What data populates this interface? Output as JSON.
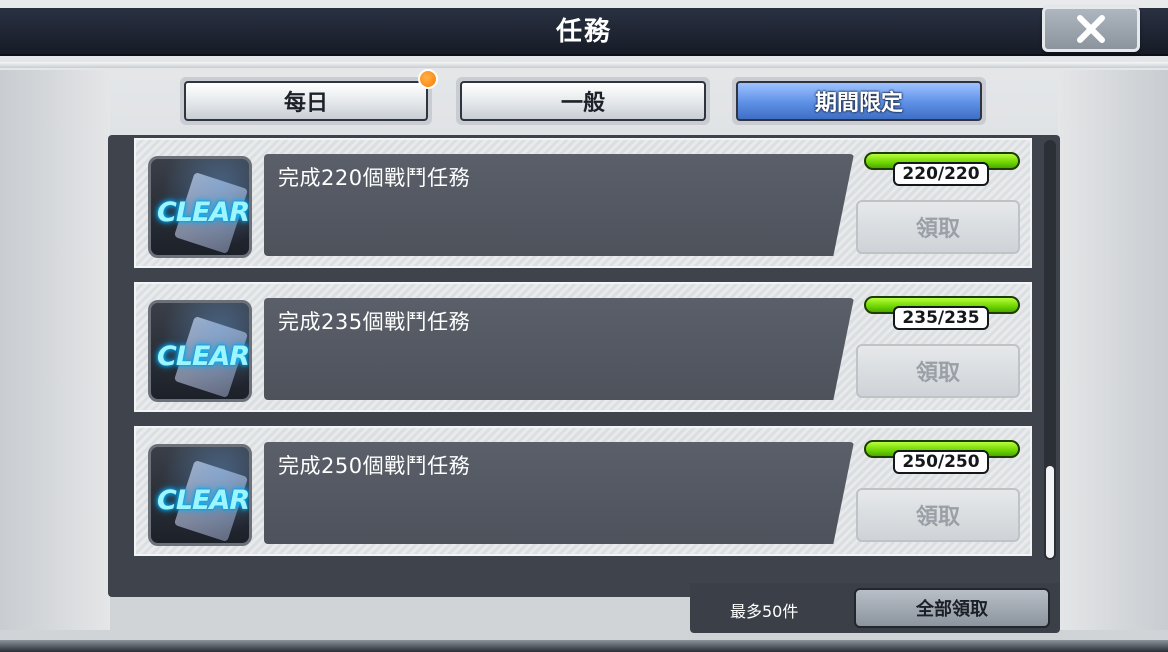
{
  "header": {
    "title": "任務"
  },
  "tabs": [
    {
      "label": "每日",
      "active": false,
      "notification": true
    },
    {
      "label": "一般",
      "active": false,
      "notification": false
    },
    {
      "label": "期間限定",
      "active": true,
      "notification": false
    }
  ],
  "missions": [
    {
      "badge": "CLEAR",
      "description": "完成220個戰鬥任務",
      "progress": "220/220",
      "progress_fraction": 1.0,
      "claim_label": "領取"
    },
    {
      "badge": "CLEAR",
      "description": "完成235個戰鬥任務",
      "progress": "235/235",
      "progress_fraction": 1.0,
      "claim_label": "領取"
    },
    {
      "badge": "CLEAR",
      "description": "完成250個戰鬥任務",
      "progress": "250/250",
      "progress_fraction": 1.0,
      "claim_label": "領取"
    }
  ],
  "footer": {
    "max_label": "最多50件",
    "claim_all_label": "全部領取"
  },
  "icons": {
    "close": "close-icon",
    "clear": "clear-badge-icon"
  },
  "colors": {
    "accent_tab": "#5d8fe6",
    "progress_fill": "#6fd500",
    "notify": "#ff7a00",
    "clear_glow": "#00c8ff"
  }
}
